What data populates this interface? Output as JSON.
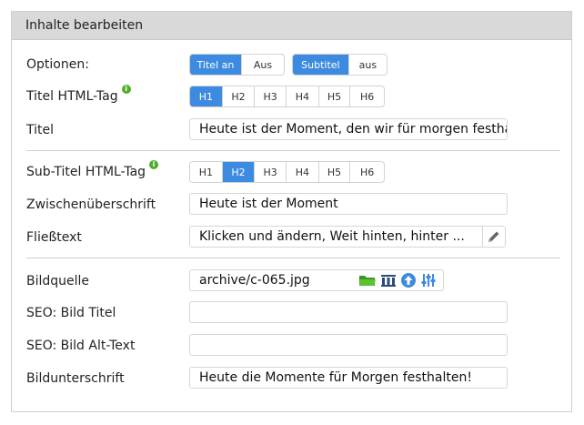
{
  "panel": {
    "title": "Inhalte bearbeiten"
  },
  "options": {
    "label": "Optionen:",
    "title_toggle": [
      {
        "label": "Titel an",
        "active": true
      },
      {
        "label": "Aus",
        "active": false
      }
    ],
    "subtitle_toggle": [
      {
        "label": "Subtitel",
        "active": true
      },
      {
        "label": "aus",
        "active": false
      }
    ]
  },
  "title_tag": {
    "label": "Titel HTML-Tag",
    "info": "i",
    "options": [
      {
        "label": "H1",
        "active": true
      },
      {
        "label": "H2",
        "active": false
      },
      {
        "label": "H3",
        "active": false
      },
      {
        "label": "H4",
        "active": false
      },
      {
        "label": "H5",
        "active": false
      },
      {
        "label": "H6",
        "active": false
      }
    ]
  },
  "title": {
    "label": "Titel",
    "value": "Heute ist der Moment, den wir für morgen festhalten"
  },
  "subtitle_tag": {
    "label": "Sub-Titel HTML-Tag",
    "info": "i",
    "options": [
      {
        "label": "H1",
        "active": false
      },
      {
        "label": "H2",
        "active": true
      },
      {
        "label": "H3",
        "active": false
      },
      {
        "label": "H4",
        "active": false
      },
      {
        "label": "H5",
        "active": false
      },
      {
        "label": "H6",
        "active": false
      }
    ]
  },
  "subheading": {
    "label": "Zwischenüberschrift",
    "value": "Heute ist der Moment"
  },
  "body_text": {
    "label": "Fließtext",
    "value": "Klicken und ändern, Weit hinten, hinter ..."
  },
  "image_source": {
    "label": "Bildquelle",
    "value": "archive/c-065.jpg"
  },
  "seo_title": {
    "label": "SEO: Bild Titel",
    "value": ""
  },
  "seo_alt": {
    "label": "SEO: Bild Alt-Text",
    "value": ""
  },
  "caption": {
    "label": "Bildunterschrift",
    "value": "Heute die Momente für Morgen festhalten!"
  },
  "colors": {
    "accent": "#3d8be0",
    "info": "#4caf2a",
    "folder": "#4caf2a",
    "header_bg": "#d9d9d9"
  },
  "icons": [
    "folder-icon",
    "archive-icon",
    "upload-icon",
    "sliders-icon",
    "pencil-icon",
    "info-icon"
  ]
}
